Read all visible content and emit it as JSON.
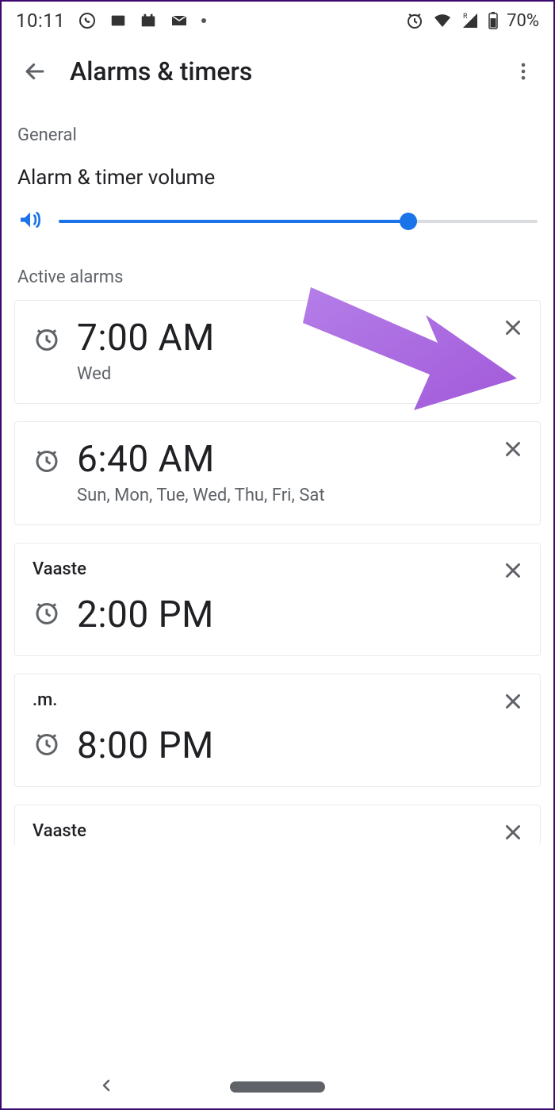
{
  "status": {
    "time": "10:11",
    "battery_pct": "70%"
  },
  "header": {
    "title": "Alarms & timers"
  },
  "sections": {
    "general_label": "General",
    "volume_label": "Alarm & timer volume",
    "active_label": "Active alarms"
  },
  "slider": {
    "value_pct": 73
  },
  "alarms": [
    {
      "title": "",
      "time": "7:00 AM",
      "sub": "Wed"
    },
    {
      "title": "",
      "time": "6:40 AM",
      "sub": "Sun, Mon, Tue, Wed, Thu, Fri, Sat"
    },
    {
      "title": "Vaaste",
      "time": "2:00 PM",
      "sub": ""
    },
    {
      "title": ".m.",
      "time": "8:00 PM",
      "sub": ""
    },
    {
      "title": "Vaaste",
      "time": "",
      "sub": ""
    }
  ]
}
